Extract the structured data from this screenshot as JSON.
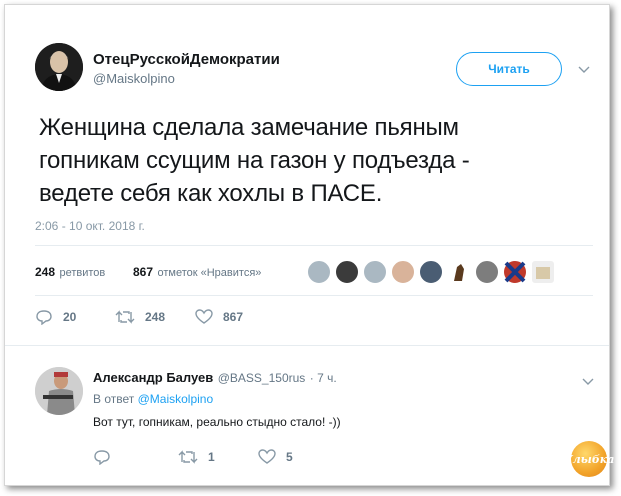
{
  "tweet": {
    "author_name": "ОтецРусскойДемократии",
    "author_handle": "@Maiskolpino",
    "follow_label": "Читать",
    "text_line1": "Женщина сделала замечание пьяным",
    "text_line2": "гопникам ссущим на газон у подъезда -",
    "text_line3": "ведете себя как хохлы в ПАСЕ.",
    "timestamp": "2:06 - 10 окт. 2018 г.",
    "retweets_count": "248",
    "retweets_label": "ретвитов",
    "likes_count": "867",
    "likes_label": "отметок «Нравится»",
    "actions": {
      "reply_count": "20",
      "retweet_count": "248",
      "like_count": "867"
    }
  },
  "reply": {
    "author_name": "Александр Балуев",
    "author_handle": "@BASS_150rus",
    "time": "· 7 ч.",
    "reply_prefix": "В ответ",
    "reply_to_handle": "@Maiskolpino",
    "text": "Вот тут, гопникам, реально стыдно стало! -))",
    "actions": {
      "reply_count": "",
      "retweet_count": "1",
      "like_count": "5"
    }
  },
  "watermark": "Улыбка",
  "colors": {
    "accent": "#1da1f2",
    "muted": "#657786",
    "text": "#14171a"
  }
}
